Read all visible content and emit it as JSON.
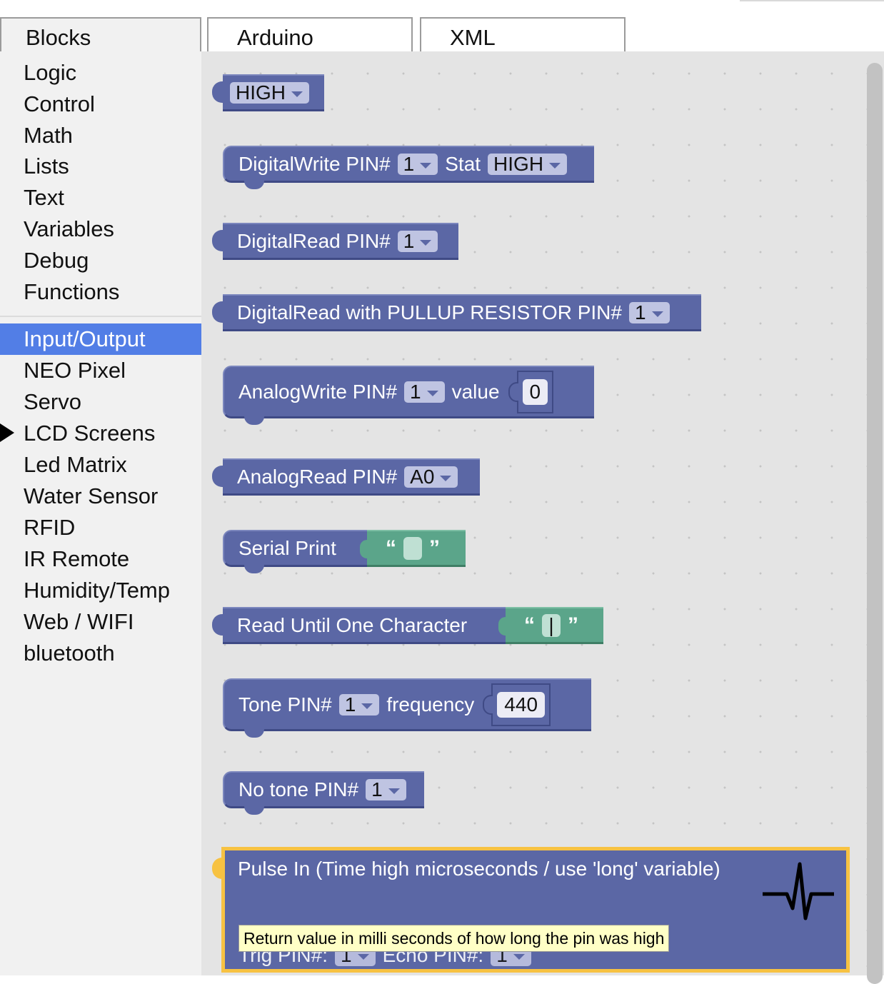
{
  "tabs": {
    "blocks": "Blocks",
    "arduino": "Arduino",
    "xml": "XML"
  },
  "categories": {
    "logic": "Logic",
    "control": "Control",
    "math": "Math",
    "lists": "Lists",
    "text": "Text",
    "variables": "Variables",
    "debug": "Debug",
    "functions": "Functions",
    "input_output": "Input/Output",
    "neo_pixel": "NEO Pixel",
    "servo": "Servo",
    "lcd_screens": "LCD Screens",
    "led_matrix": "Led Matrix",
    "water_sensor": "Water Sensor",
    "rfid": "RFID",
    "ir_remote": "IR Remote",
    "humidity_temp": "Humidity/Temp",
    "web_wifi": "Web / WIFI",
    "bluetooth": "bluetooth"
  },
  "blocks": {
    "high": {
      "value": "HIGH"
    },
    "digital_write": {
      "label": "DigitalWrite PIN#",
      "pin": "1",
      "stat_label": "Stat",
      "stat": "HIGH"
    },
    "digital_read": {
      "label": "DigitalRead PIN#",
      "pin": "1"
    },
    "digital_read_pullup": {
      "label": "DigitalRead with PULLUP RESISTOR PIN#",
      "pin": "1"
    },
    "analog_write": {
      "label": "AnalogWrite PIN#",
      "pin": "1",
      "value_label": "value",
      "value": "0"
    },
    "analog_read": {
      "label": "AnalogRead PIN#",
      "pin": "A0"
    },
    "serial_print": {
      "label": "Serial Print",
      "open_quote": "“",
      "close_quote": "”",
      "text": ""
    },
    "read_until": {
      "label": "Read Until One Character",
      "open_quote": "“",
      "close_quote": "”",
      "text": "|"
    },
    "tone": {
      "label": "Tone PIN#",
      "pin": "1",
      "freq_label": "frequency",
      "freq": "440"
    },
    "no_tone": {
      "label": "No tone PIN#",
      "pin": "1"
    },
    "pulse_in": {
      "label": "Pulse In (Time high microseconds / use 'long' variable)",
      "trig_label": "Trig PIN#:",
      "trig": "1",
      "echo_label": "Echo PIN#:",
      "echo": "1",
      "icon": "pulse-icon"
    }
  },
  "tooltip": "Return value in milli seconds of how long the pin was high",
  "colors": {
    "block": "#5b67a5",
    "text_block": "#5ba58a",
    "selected": "#527ee6",
    "highlight": "#f7c242"
  }
}
